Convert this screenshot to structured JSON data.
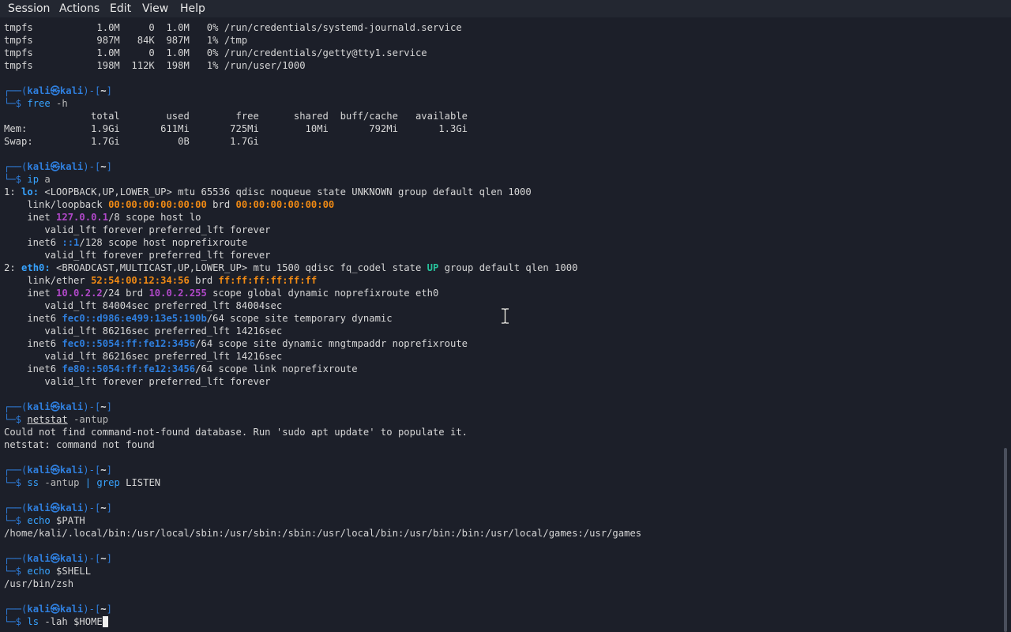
{
  "menubar": {
    "items": [
      "Session",
      "Actions",
      "Edit",
      "View",
      "Help"
    ]
  },
  "prompt": {
    "prefix": "┌──(",
    "user": "kali",
    "at": "㉿",
    "host": "kali",
    "mid": ")-[",
    "dir": "~",
    "suffix": "]",
    "line2": "└─$ "
  },
  "df_rows": [
    "tmpfs           1.0M     0  1.0M   0% /run/credentials/systemd-journald.service",
    "tmpfs           987M   84K  987M   1% /tmp",
    "tmpfs           1.0M     0  1.0M   0% /run/credentials/getty@tty1.service",
    "tmpfs           198M  112K  198M   1% /run/user/1000"
  ],
  "cmd_free": {
    "cmd": "free",
    "args": " -h"
  },
  "free_output": [
    "               total        used        free      shared  buff/cache   available",
    "Mem:           1.9Gi       611Mi       725Mi        10Mi       792Mi       1.3Gi",
    "Swap:          1.7Gi          0B       1.7Gi"
  ],
  "cmd_ip": {
    "cmd": "ip",
    "args": " a"
  },
  "ip_output": {
    "lo_num": "1: ",
    "lo_name": "lo:",
    "lo_flags": " <LOOPBACK,UP,LOWER_UP> mtu 65536 qdisc noqueue state UNKNOWN group default qlen 1000",
    "lo_link_pre": "    link/loopback ",
    "lo_mac": "00:00:00:00:00:00",
    "lo_brd": " brd ",
    "lo_brd_mac": "00:00:00:00:00:00",
    "lo_inet_pre": "    inet ",
    "lo_inet": "127.0.0.1",
    "lo_inet_post": "/8 scope host lo",
    "lft_forever": "       valid_lft forever preferred_lft forever",
    "lo_inet6_pre": "    inet6 ",
    "lo_inet6": "::1",
    "lo_inet6_post": "/128 scope host noprefixroute",
    "eth_num": "2: ",
    "eth_name": "eth0:",
    "eth_flags_a": " <BROADCAST,MULTICAST,UP,LOWER_UP> mtu 1500 qdisc fq_codel state ",
    "eth_state": "UP",
    "eth_flags_b": " group default qlen 1000",
    "eth_link_pre": "    link/ether ",
    "eth_mac": "52:54:00:12:34:56",
    "eth_brd": " brd ",
    "eth_brd_mac": "ff:ff:ff:ff:ff:ff",
    "eth_inet_pre": "    inet ",
    "eth_inet": "10.0.2.2",
    "eth_inet_mid": "/24 brd ",
    "eth_inet_brd": "10.0.2.255",
    "eth_inet_post": " scope global dynamic noprefixroute eth0",
    "lft_84004": "       valid_lft 84004sec preferred_lft 84004sec",
    "eth_inet6a_pre": "    inet6 ",
    "eth_inet6a": "fec0::d986:e499:13e5:190b",
    "eth_inet6a_post": "/64 scope site temporary dynamic",
    "lft_86216": "       valid_lft 86216sec preferred_lft 14216sec",
    "eth_inet6b_pre": "    inet6 ",
    "eth_inet6b": "fec0::5054:ff:fe12:3456",
    "eth_inet6b_post": "/64 scope site dynamic mngtmpaddr noprefixroute",
    "eth_inet6c_pre": "    inet6 ",
    "eth_inet6c": "fe80::5054:ff:fe12:3456",
    "eth_inet6c_post": "/64 scope link noprefixroute"
  },
  "cmd_netstat": {
    "cmd": "netstat",
    "args": " -antup"
  },
  "netstat_output": [
    "Could not find command-not-found database. Run 'sudo apt update' to populate it.",
    "netstat: command not found"
  ],
  "cmd_ss": {
    "cmd": "ss",
    "args": " -antup ",
    "pipe": "|",
    "cmd2": " grep",
    "args2": " LISTEN"
  },
  "cmd_path": {
    "cmd": "echo",
    "args": " $PATH"
  },
  "path_output": "/home/kali/.local/bin:/usr/local/sbin:/usr/sbin:/sbin:/usr/local/bin:/usr/bin:/bin:/usr/local/games:/usr/games",
  "cmd_shell": {
    "cmd": "echo",
    "args": " $SHELL"
  },
  "shell_output": "/usr/bin/zsh",
  "cmd_ls": {
    "cmd": "ls",
    "args": " -lah $HOME"
  }
}
